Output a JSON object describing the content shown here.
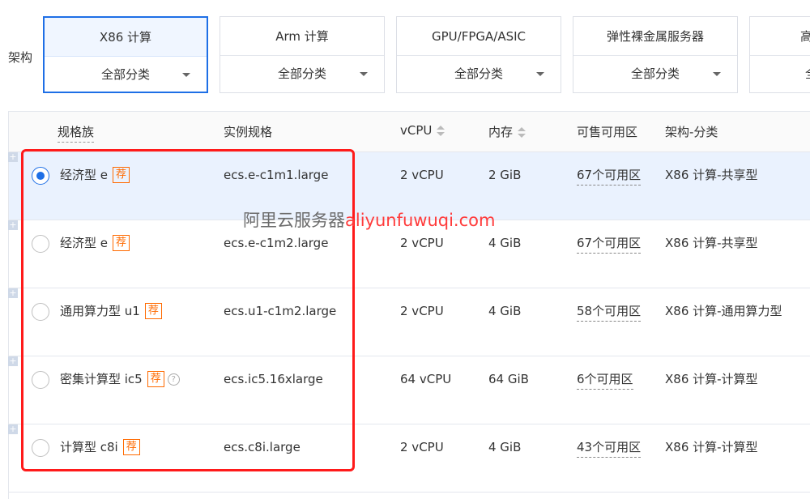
{
  "arch_label": "架构",
  "arch_tabs": [
    {
      "title": "X86 计算",
      "category": "全部分类",
      "active": true
    },
    {
      "title": "Arm 计算",
      "category": "全部分类",
      "active": false
    },
    {
      "title": "GPU/FPGA/ASIC",
      "category": "全部分类",
      "active": false
    },
    {
      "title": "弹性裸金属服务器",
      "category": "全部分类",
      "active": false
    },
    {
      "title": "高",
      "category": "全",
      "active": false
    }
  ],
  "table": {
    "headers": {
      "family": "规格族",
      "spec": "实例规格",
      "vcpu": "vCPU",
      "memory": "内存",
      "zones": "可售可用区",
      "arch": "架构-分类"
    },
    "rows": [
      {
        "family": "经济型 e",
        "badge": "荐",
        "spec": "ecs.e-c1m1.large",
        "vcpu": "2 vCPU",
        "memory": "2 GiB",
        "zones": "67个可用区",
        "arch": "X86 计算-共享型",
        "selected": true,
        "help": false
      },
      {
        "family": "经济型 e",
        "badge": "荐",
        "spec": "ecs.e-c1m2.large",
        "vcpu": "2 vCPU",
        "memory": "4 GiB",
        "zones": "67个可用区",
        "arch": "X86 计算-共享型",
        "selected": false,
        "help": false
      },
      {
        "family": "通用算力型 u1",
        "badge": "荐",
        "spec": "ecs.u1-c1m2.large",
        "vcpu": "2 vCPU",
        "memory": "4 GiB",
        "zones": "58个可用区",
        "arch": "X86 计算-通用算力型",
        "selected": false,
        "help": false
      },
      {
        "family": "密集计算型 ic5",
        "badge": "荐",
        "spec": "ecs.ic5.16xlarge",
        "vcpu": "64 vCPU",
        "memory": "64 GiB",
        "zones": "6个可用区",
        "arch": "X86 计算-计算型",
        "selected": false,
        "help": true
      },
      {
        "family": "计算型 c8i",
        "badge": "荐",
        "spec": "ecs.c8i.large",
        "vcpu": "2 vCPU",
        "memory": "4 GiB",
        "zones": "43个可用区",
        "arch": "X86 计算-计算型",
        "selected": false,
        "help": false
      }
    ]
  },
  "watermark": {
    "cn": "阿里云服务器",
    "url": "aliyunfuwuqi.com"
  },
  "colors": {
    "accent": "#1e6fe6",
    "badge": "#ff6a00",
    "highlight": "#ff1a1a"
  }
}
